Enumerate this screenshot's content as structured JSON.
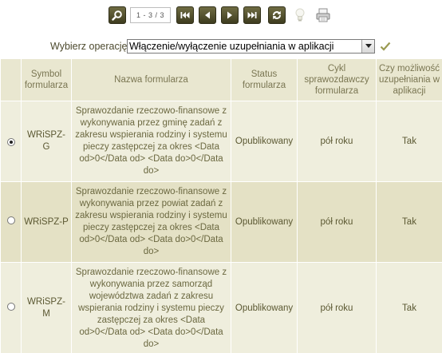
{
  "toolbar": {
    "page_indicator": "1 - 3 / 3",
    "icons": [
      "search-icon",
      "first-page-icon",
      "prev-page-icon",
      "next-page-icon",
      "last-page-icon",
      "refresh-icon",
      "lightbulb-icon",
      "printer-icon"
    ]
  },
  "operation": {
    "label": "Wybierz operację:",
    "selected": "Włączenie/wyłączenie uzupełniania w aplikacji"
  },
  "table": {
    "headers": {
      "symbol": "Symbol formularza",
      "name": "Nazwa formularza",
      "status": "Status formularza",
      "cycle": "Cykl sprawozdawczy formularza",
      "fill": "Czy możliwość uzupełniania w aplikacji"
    },
    "rows": [
      {
        "selected": true,
        "symbol": "WRiSPZ-G",
        "name": "Sprawozdanie rzeczowo-finansowe z wykonywania przez gminę zadań z zakresu wspierania rodziny i systemu pieczy zastępczej za okres <Data od>0</Data od> <Data do>0</Data do>",
        "status": "Opublikowany",
        "cycle": "pół roku",
        "fill": "Tak"
      },
      {
        "selected": false,
        "symbol": "WRiSPZ-P",
        "name": "Sprawozdanie rzeczowo-finansowe z wykonywania przez powiat zadań z zakresu wspierania rodziny i systemu pieczy zastępczej za okres <Data od>0</Data od> <Data do>0</Data do>",
        "status": "Opublikowany",
        "cycle": "pół roku",
        "fill": "Tak"
      },
      {
        "selected": false,
        "symbol": "WRiSPZ-M",
        "name": "Sprawozdanie rzeczowo-finansowe z wykonywania przez samorząd województwa zadań z zakresu wspierania rodziny i systemu pieczy zastępczej za okres <Data od>0</Data od> <Data do>0</Data do>",
        "status": "Opublikowany",
        "cycle": "pół roku",
        "fill": "Tak"
      }
    ]
  }
}
